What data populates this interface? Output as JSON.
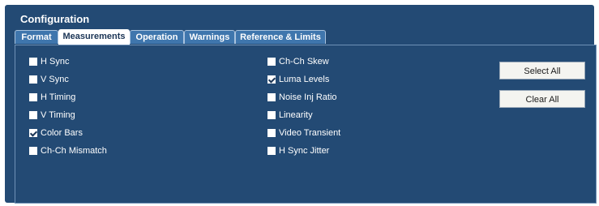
{
  "panel": {
    "title": "Configuration"
  },
  "tabs": [
    {
      "label": "Format",
      "active": false
    },
    {
      "label": "Measurements",
      "active": true
    },
    {
      "label": "Operation",
      "active": false
    },
    {
      "label": "Warnings",
      "active": false
    },
    {
      "label": "Reference & Limits",
      "active": false
    }
  ],
  "measurements": {
    "left": [
      {
        "label": "H Sync",
        "checked": false
      },
      {
        "label": "V Sync",
        "checked": false
      },
      {
        "label": "H Timing",
        "checked": false
      },
      {
        "label": "V Timing",
        "checked": false
      },
      {
        "label": "Color Bars",
        "checked": true
      },
      {
        "label": "Ch-Ch Mismatch",
        "checked": false
      }
    ],
    "right": [
      {
        "label": "Ch-Ch Skew",
        "checked": false
      },
      {
        "label": "Luma Levels",
        "checked": true
      },
      {
        "label": "Noise Inj Ratio",
        "checked": false
      },
      {
        "label": "Linearity",
        "checked": false
      },
      {
        "label": "Video Transient",
        "checked": false
      },
      {
        "label": "H Sync Jitter",
        "checked": false
      }
    ]
  },
  "buttons": {
    "select_all": "Select All",
    "clear_all": "Clear All"
  }
}
